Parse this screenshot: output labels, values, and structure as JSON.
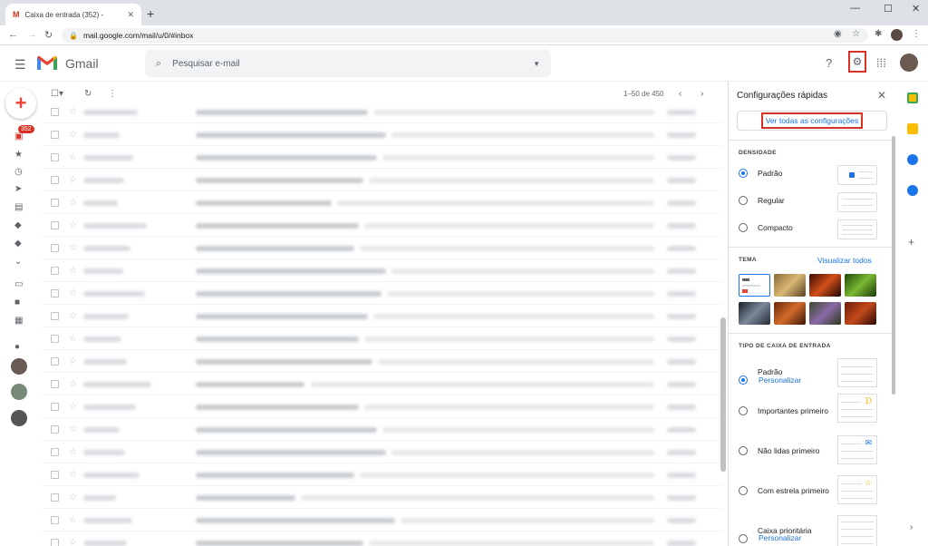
{
  "browser": {
    "tab_title": "Caixa de entrada (352) -",
    "tab_favicon": "M",
    "tab_close": "✕",
    "new_tab": "+",
    "url": "mail.google.com/mail/u/0/#inbox",
    "win_min": "—",
    "win_max": "☐",
    "win_close": "✕"
  },
  "header": {
    "app_name": "Gmail",
    "search_placeholder": "Pesquisar e-mail"
  },
  "sidebar": {
    "inbox_badge": "352"
  },
  "toolbar": {
    "pagination": "1–50 de 450"
  },
  "quick_settings": {
    "title": "Configurações rápidas",
    "see_all": "Ver todas as configurações",
    "density": {
      "label": "DENSIDADE",
      "options": [
        "Padrão",
        "Regular",
        "Compacto"
      ],
      "selected": "Padrão"
    },
    "theme": {
      "label": "TEMA",
      "view_all": "Visualizar todos"
    },
    "inbox_type": {
      "label": "TIPO DE CAIXA DE ENTRADA",
      "options": [
        "Padrão",
        "Importantes primeiro",
        "Não lidas primeiro",
        "Com estrela primeiro",
        "Caixa prioritária"
      ],
      "customize": "Personalizar",
      "selected": "Padrão"
    }
  },
  "colors": {
    "accent": "#1a73e8",
    "highlight": "#d93025",
    "gmail_red": "#ea4335"
  }
}
